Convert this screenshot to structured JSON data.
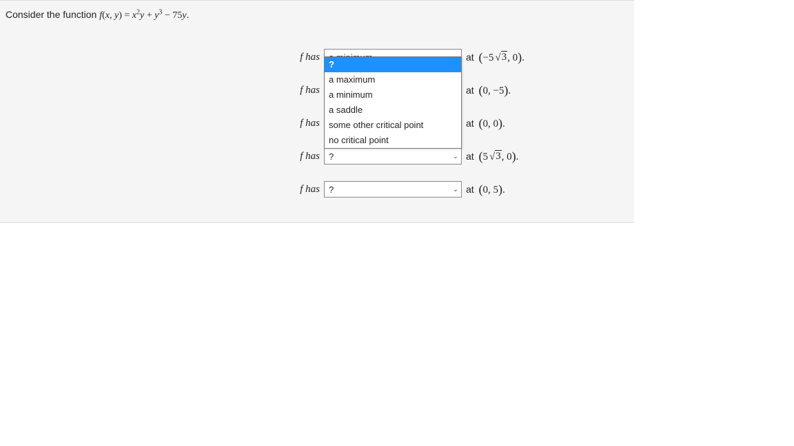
{
  "stem": {
    "prefix": "Consider the function ",
    "func_lhs": "f(x, y)",
    "eq": " = ",
    "func_rhs_html": "x²y + y³ − 75y",
    "suffix": "."
  },
  "label_prefix": "f ",
  "label_word": "has",
  "options": [
    "?",
    "a maximum",
    "a minimum",
    "a saddle",
    "some other critical point",
    "no critical point"
  ],
  "rows": [
    {
      "selected": "a minimum",
      "open": true,
      "point_html": "(−5√3, 0)"
    },
    {
      "selected": "?",
      "open": false,
      "point_html": "(0, −5)"
    },
    {
      "selected": "?",
      "open": false,
      "point_html": "(0, 0)"
    },
    {
      "selected": "?",
      "open": false,
      "point_html": "(5√3, 0)"
    },
    {
      "selected": "?",
      "open": false,
      "point_html": "(0, 5)"
    }
  ],
  "at_word": "at"
}
